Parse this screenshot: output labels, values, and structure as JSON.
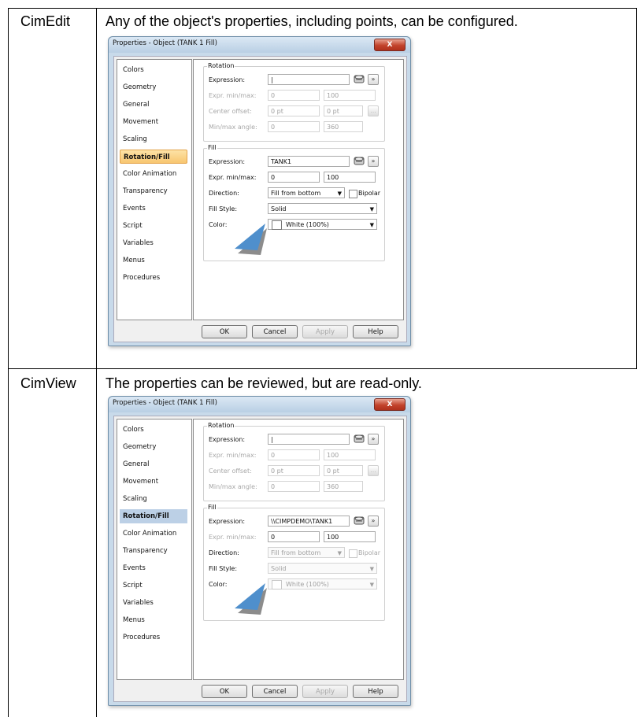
{
  "rows": [
    {
      "label": "CimEdit",
      "description": "Any of the object's properties, including points, can be configured.",
      "dialog": {
        "title": "Properties - Object (TANK 1 Fill)",
        "close": "X",
        "nav": [
          "Colors",
          "Geometry",
          "General",
          "Movement",
          "Scaling",
          "Rotation/Fill",
          "Color Animation",
          "Transparency",
          "Events",
          "Script",
          "Variables",
          "Menus",
          "Procedures"
        ],
        "selected": "Rotation/Fill",
        "rotation": {
          "group": "Rotation",
          "expression_label": "Expression:",
          "expression_value": "|",
          "minmax_label": "Expr. min/max:",
          "min": "0",
          "max": "100",
          "center_label": "Center offset:",
          "center_x": "0 pt",
          "center_y": "0 pt",
          "angle_label": "Min/max angle:",
          "angle_min": "0",
          "angle_max": "360",
          "arrow_btn": "»",
          "dots_btn": "..."
        },
        "fill": {
          "group": "Fill",
          "expression_label": "Expression:",
          "expression_value": "TANK1",
          "minmax_label": "Expr. min/max:",
          "min": "0",
          "max": "100",
          "direction_label": "Direction:",
          "direction_value": "Fill from bottom",
          "bipolar_label": "Bipolar",
          "style_label": "Fill Style:",
          "style_value": "Solid",
          "color_label": "Color:",
          "color_value": "White (100%)",
          "arrow_btn": "»"
        },
        "buttons": {
          "ok": "OK",
          "cancel": "Cancel",
          "apply": "Apply",
          "help": "Help"
        }
      }
    },
    {
      "label": "CimView",
      "description": "The properties can be reviewed, but are read-only.",
      "dialog": {
        "title": "Properties - Object (TANK 1 Fill)",
        "close": "X",
        "nav": [
          "Colors",
          "Geometry",
          "General",
          "Movement",
          "Scaling",
          "Rotation/Fill",
          "Color Animation",
          "Transparency",
          "Events",
          "Script",
          "Variables",
          "Menus",
          "Procedures"
        ],
        "selected": "Rotation/Fill",
        "rotation": {
          "group": "Rotation",
          "expression_label": "Expression:",
          "expression_value": "|",
          "minmax_label": "Expr. min/max:",
          "min": "0",
          "max": "100",
          "center_label": "Center offset:",
          "center_x": "0 pt",
          "center_y": "0 pt",
          "angle_label": "Min/max angle:",
          "angle_min": "0",
          "angle_max": "360",
          "arrow_btn": "»",
          "dots_btn": "..."
        },
        "fill": {
          "group": "Fill",
          "expression_label": "Expression:",
          "expression_value": "\\\\CIMPDEMO\\TANK1",
          "minmax_label": "Expr. min/max:",
          "min": "0",
          "max": "100",
          "direction_label": "Direction:",
          "direction_value": "Fill from bottom",
          "bipolar_label": "Bipolar",
          "style_label": "Fill Style:",
          "style_value": "Solid",
          "color_label": "Color:",
          "color_value": "White (100%)",
          "arrow_btn": "»"
        },
        "buttons": {
          "ok": "OK",
          "cancel": "Cancel",
          "apply": "Apply",
          "help": "Help"
        }
      }
    }
  ]
}
